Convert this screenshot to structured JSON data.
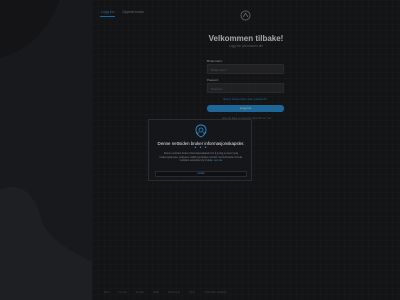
{
  "tabs": [
    {
      "label": "Logg inn",
      "active": true
    },
    {
      "label": "Opprett konto",
      "active": false
    }
  ],
  "login": {
    "title": "Velkommen tilbake!",
    "subtitle": "Logg inn på kontoen din",
    "username_label": "Brukernavn",
    "username_placeholder": "Brukernavn",
    "password_label": "Passord",
    "password_placeholder": "Passord",
    "forgot_text": "Glemt brukernavn eller passord?",
    "submit_label": "Logg inn",
    "bottom_link": "Har du ikke en konto? Opprett en her"
  },
  "cookie_modal": {
    "title": "Denne nettsiden bruker informasjonskapsler.",
    "dots": "• • •",
    "body": "Denne nettsiden bruker informasjonskapsler for å gi deg en best mulig brukeropplevelse, analysere trafikk og tilpasse innhold. Ved å fortsette å bruke nettsiden samtykker du til dette.",
    "more_link": "Les mer",
    "accept_label": "Godta"
  },
  "footer": [
    "Hjem",
    "Om oss",
    "Kontakt",
    "Vilkår",
    "Personvern",
    "Hjelp",
    "© 2024 Alle rettigheter"
  ],
  "icons": {
    "logo": "brand-logo-icon",
    "modal": "cookie-shield-icon"
  },
  "colors": {
    "accent": "#2d8fd5",
    "background": "#1b1c1e",
    "panel": "#15161a"
  }
}
